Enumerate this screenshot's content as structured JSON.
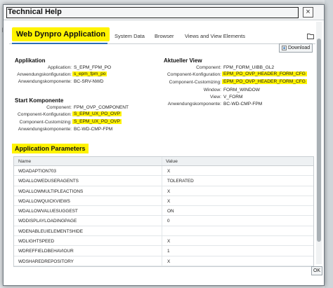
{
  "dialog": {
    "title": "Technical Help",
    "close_glyph": "×",
    "ok_label": "OK"
  },
  "background": {
    "left_label": "D"
  },
  "tabs": [
    {
      "label": "Web Dynpro Application",
      "active": true
    },
    {
      "label": "System Data"
    },
    {
      "label": "Browser"
    },
    {
      "label": "Views and View Elements"
    }
  ],
  "download_label": "Download",
  "applikation": {
    "title": "Applikation",
    "rows": [
      {
        "label": "Application:",
        "value": "S_EPM_FPM_PO",
        "highlight": false
      },
      {
        "label": "Anwendungskonfiguration:",
        "value": "s_epm_fpm_po",
        "highlight": true
      },
      {
        "label": "Anwendungskomponente:",
        "value": "BC-SRV-NWD",
        "highlight": false
      }
    ]
  },
  "start_komponente": {
    "title": "Start Komponente",
    "rows": [
      {
        "label": "Component:",
        "value": "FPM_OVP_COMPONENT",
        "highlight": false
      },
      {
        "label": "Component-Konfiguration:",
        "value": "S_EPM_UX_PO_OVP",
        "highlight": true
      },
      {
        "label": "Component-Customizing:",
        "value": "S_EPM_UX_PO_OVP",
        "highlight": true
      },
      {
        "label": "Anwendungskomponente:",
        "value": "BC-WD-CMP-FPM",
        "highlight": false
      }
    ]
  },
  "aktueller_view": {
    "title": "Aktueller View",
    "rows": [
      {
        "label": "Component:",
        "value": "FPM_FORM_UIBB_GL2",
        "highlight": false
      },
      {
        "label": "Component-Konfiguration:",
        "value": "EPM_PO_OVP_HEADER_FORM_CFG",
        "highlight": true
      },
      {
        "label": "Component-Customizing:",
        "value": "EPM_PO_OVP_HEADER_FORM_CFG",
        "highlight": true
      },
      {
        "label": "Window:",
        "value": "FORM_WINDOW",
        "highlight": false
      },
      {
        "label": "View:",
        "value": "V_FORM",
        "highlight": false
      },
      {
        "label": "Anwendungskomponente:",
        "value": "BC-WD-CMP-FPM",
        "highlight": false
      }
    ]
  },
  "application_parameters": {
    "title": "Application Parameters",
    "columns": [
      "Name",
      "Value"
    ],
    "rows": [
      {
        "name": "WDADAPTION703",
        "value": "X"
      },
      {
        "name": "WDALLOWEDUSERAGENTS",
        "value": "TOLERATED"
      },
      {
        "name": "WDALLOWMULTIPLEACTIONS",
        "value": "X"
      },
      {
        "name": "WDALLOWQUICKVIEWS",
        "value": "X"
      },
      {
        "name": "WDALLOWVALUESUGGEST",
        "value": "ON"
      },
      {
        "name": "WDDISPLAYLOADINGPAGE",
        "value": "0"
      },
      {
        "name": "WDENABLEUIELEMENTSHIDE",
        "value": ""
      },
      {
        "name": "WDLIGHTSPEED",
        "value": "X"
      },
      {
        "name": "WDREFFIELDBEHAVIOUR",
        "value": "1"
      },
      {
        "name": "WDSHAREDREPOSITORY",
        "value": "X"
      }
    ]
  },
  "colors": {
    "highlight": "#fff300",
    "tab_underline": "#2b6fb6"
  }
}
